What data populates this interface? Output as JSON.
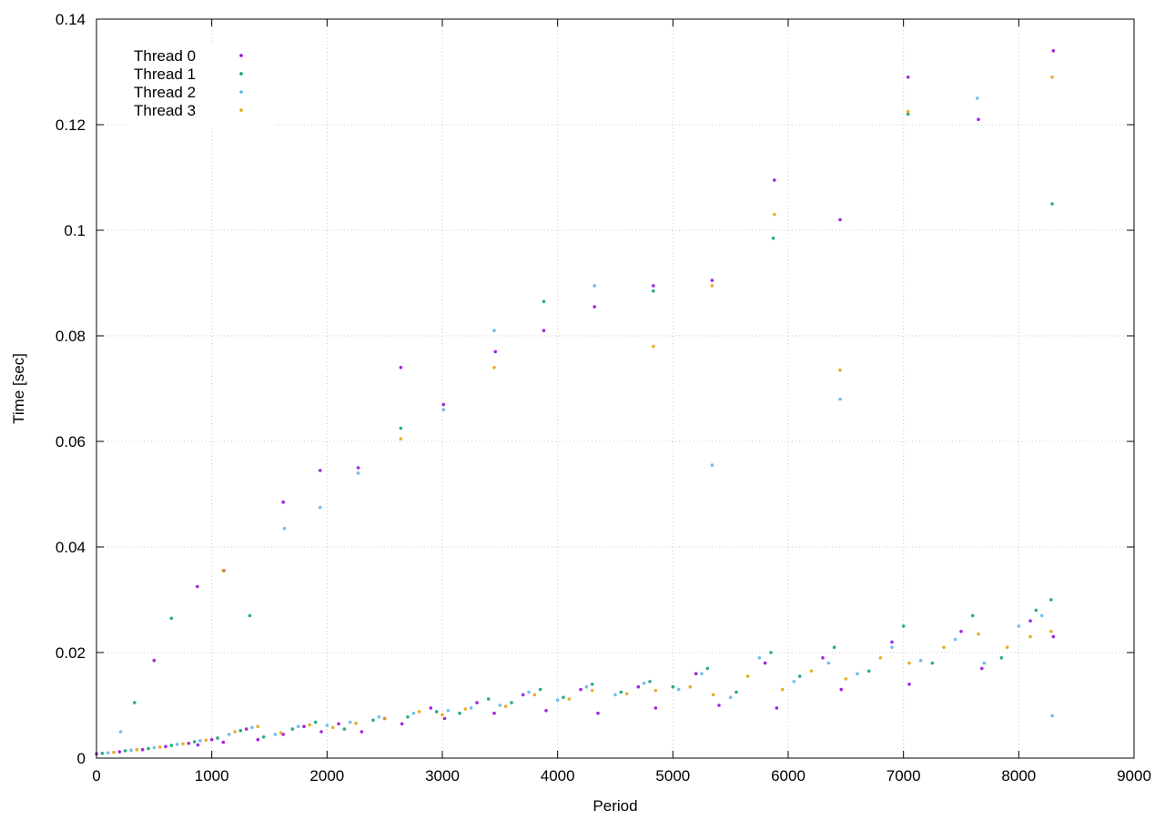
{
  "chart_data": {
    "type": "scatter",
    "title": "",
    "xlabel": "Period",
    "ylabel": "Time [sec]",
    "xlim": [
      0,
      9000
    ],
    "ylim": [
      0,
      0.14
    ],
    "xticks": [
      "0",
      "1000",
      "2000",
      "3000",
      "4000",
      "5000",
      "6000",
      "7000",
      "8000",
      "9000"
    ],
    "yticks": [
      "0",
      "0.02",
      "0.04",
      "0.06",
      "0.08",
      "0.1",
      "0.12",
      "0.14"
    ],
    "grid": true,
    "legend_position": "top-left",
    "series": [
      {
        "name": "Thread 0",
        "color": "#9400d3",
        "marker": "dot",
        "values": [
          [
            0,
            0.0008
          ],
          [
            200,
            0.0012
          ],
          [
            400,
            0.0016
          ],
          [
            600,
            0.0022
          ],
          [
            800,
            0.0028
          ],
          [
            880,
            0.0025
          ],
          [
            1000,
            0.0035
          ],
          [
            1100,
            0.003
          ],
          [
            1300,
            0.0055
          ],
          [
            1400,
            0.0035
          ],
          [
            1620,
            0.0045
          ],
          [
            1800,
            0.006
          ],
          [
            1950,
            0.005
          ],
          [
            2100,
            0.0065
          ],
          [
            2300,
            0.005
          ],
          [
            2500,
            0.0075
          ],
          [
            2650,
            0.0065
          ],
          [
            2900,
            0.0095
          ],
          [
            3020,
            0.0075
          ],
          [
            3300,
            0.0105
          ],
          [
            3450,
            0.0085
          ],
          [
            3700,
            0.012
          ],
          [
            3900,
            0.009
          ],
          [
            4200,
            0.013
          ],
          [
            4350,
            0.0085
          ],
          [
            4700,
            0.0135
          ],
          [
            4850,
            0.0095
          ],
          [
            5200,
            0.016
          ],
          [
            5400,
            0.01
          ],
          [
            5800,
            0.018
          ],
          [
            5900,
            0.0095
          ],
          [
            6300,
            0.019
          ],
          [
            6460,
            0.013
          ],
          [
            6900,
            0.022
          ],
          [
            7050,
            0.014
          ],
          [
            7500,
            0.024
          ],
          [
            7680,
            0.017
          ],
          [
            8100,
            0.026
          ],
          [
            8300,
            0.023
          ],
          [
            500,
            0.0185
          ],
          [
            875,
            0.0325
          ],
          [
            1105,
            0.0355
          ],
          [
            1620,
            0.0485
          ],
          [
            1940,
            0.0545
          ],
          [
            2270,
            0.055
          ],
          [
            2640,
            0.074
          ],
          [
            3010,
            0.067
          ],
          [
            3460,
            0.077
          ],
          [
            3880,
            0.081
          ],
          [
            4320,
            0.0855
          ],
          [
            4830,
            0.0895
          ],
          [
            5340,
            0.0905
          ],
          [
            5880,
            0.1095
          ],
          [
            6450,
            0.102
          ],
          [
            7040,
            0.129
          ],
          [
            7650,
            0.121
          ],
          [
            8300,
            0.134
          ]
        ]
      },
      {
        "name": "Thread 1",
        "color": "#009e73",
        "marker": "dot",
        "values": [
          [
            50,
            0.0009
          ],
          [
            250,
            0.0014
          ],
          [
            450,
            0.0018
          ],
          [
            650,
            0.0024
          ],
          [
            850,
            0.0031
          ],
          [
            1050,
            0.0038
          ],
          [
            1250,
            0.0052
          ],
          [
            1450,
            0.004
          ],
          [
            1700,
            0.0055
          ],
          [
            1900,
            0.0068
          ],
          [
            2150,
            0.0055
          ],
          [
            2400,
            0.0072
          ],
          [
            2700,
            0.0078
          ],
          [
            2950,
            0.0088
          ],
          [
            3150,
            0.0085
          ],
          [
            3400,
            0.0112
          ],
          [
            3600,
            0.0105
          ],
          [
            3850,
            0.013
          ],
          [
            4050,
            0.0115
          ],
          [
            4300,
            0.014
          ],
          [
            4550,
            0.0125
          ],
          [
            4800,
            0.0145
          ],
          [
            5000,
            0.0135
          ],
          [
            5300,
            0.017
          ],
          [
            5550,
            0.0125
          ],
          [
            5850,
            0.02
          ],
          [
            6100,
            0.0155
          ],
          [
            6400,
            0.021
          ],
          [
            6700,
            0.0165
          ],
          [
            7000,
            0.025
          ],
          [
            7250,
            0.018
          ],
          [
            7600,
            0.027
          ],
          [
            7850,
            0.019
          ],
          [
            8150,
            0.028
          ],
          [
            8280,
            0.03
          ],
          [
            330,
            0.0105
          ],
          [
            650,
            0.0265
          ],
          [
            1330,
            0.027
          ],
          [
            2640,
            0.0625
          ],
          [
            3880,
            0.0865
          ],
          [
            4830,
            0.0885
          ],
          [
            5870,
            0.0985
          ],
          [
            7040,
            0.122
          ],
          [
            8290,
            0.105
          ]
        ]
      },
      {
        "name": "Thread 2",
        "color": "#56b4e9",
        "marker": "dot",
        "values": [
          [
            100,
            0.001
          ],
          [
            300,
            0.0015
          ],
          [
            500,
            0.002
          ],
          [
            700,
            0.0026
          ],
          [
            900,
            0.0033
          ],
          [
            1150,
            0.0045
          ],
          [
            1350,
            0.0058
          ],
          [
            1550,
            0.0045
          ],
          [
            1750,
            0.006
          ],
          [
            2000,
            0.0062
          ],
          [
            2200,
            0.0068
          ],
          [
            2450,
            0.0078
          ],
          [
            2750,
            0.0085
          ],
          [
            3050,
            0.009
          ],
          [
            3250,
            0.0095
          ],
          [
            3500,
            0.01
          ],
          [
            3750,
            0.0125
          ],
          [
            4000,
            0.011
          ],
          [
            4250,
            0.0135
          ],
          [
            4500,
            0.012
          ],
          [
            4750,
            0.0142
          ],
          [
            5050,
            0.013
          ],
          [
            5250,
            0.016
          ],
          [
            5500,
            0.0115
          ],
          [
            5750,
            0.019
          ],
          [
            6050,
            0.0145
          ],
          [
            6350,
            0.018
          ],
          [
            6600,
            0.016
          ],
          [
            6900,
            0.021
          ],
          [
            7150,
            0.0185
          ],
          [
            7450,
            0.0225
          ],
          [
            7700,
            0.018
          ],
          [
            8000,
            0.025
          ],
          [
            8200,
            0.027
          ],
          [
            8290,
            0.008
          ],
          [
            210,
            0.005
          ],
          [
            1630,
            0.0435
          ],
          [
            1940,
            0.0475
          ],
          [
            2270,
            0.054
          ],
          [
            3010,
            0.066
          ],
          [
            3450,
            0.081
          ],
          [
            4320,
            0.0895
          ],
          [
            5340,
            0.0555
          ],
          [
            6450,
            0.068
          ],
          [
            7640,
            0.125
          ]
        ]
      },
      {
        "name": "Thread 3",
        "color": "#e69f00",
        "marker": "dot",
        "values": [
          [
            150,
            0.0011
          ],
          [
            350,
            0.0016
          ],
          [
            550,
            0.0021
          ],
          [
            750,
            0.0027
          ],
          [
            950,
            0.0034
          ],
          [
            1200,
            0.005
          ],
          [
            1400,
            0.006
          ],
          [
            1600,
            0.0048
          ],
          [
            1850,
            0.0063
          ],
          [
            2050,
            0.0058
          ],
          [
            2250,
            0.0066
          ],
          [
            2500,
            0.0075
          ],
          [
            2800,
            0.0088
          ],
          [
            3000,
            0.0082
          ],
          [
            3200,
            0.0093
          ],
          [
            3550,
            0.0098
          ],
          [
            3800,
            0.012
          ],
          [
            4100,
            0.0112
          ],
          [
            4300,
            0.0128
          ],
          [
            4600,
            0.0122
          ],
          [
            4850,
            0.0128
          ],
          [
            5150,
            0.0135
          ],
          [
            5350,
            0.012
          ],
          [
            5650,
            0.0155
          ],
          [
            5950,
            0.013
          ],
          [
            6200,
            0.0165
          ],
          [
            6500,
            0.015
          ],
          [
            6800,
            0.019
          ],
          [
            7050,
            0.018
          ],
          [
            7350,
            0.021
          ],
          [
            7650,
            0.0235
          ],
          [
            7900,
            0.021
          ],
          [
            8100,
            0.023
          ],
          [
            8280,
            0.024
          ],
          [
            1100,
            0.0355
          ],
          [
            2640,
            0.0605
          ],
          [
            3450,
            0.074
          ],
          [
            4830,
            0.078
          ],
          [
            5340,
            0.0895
          ],
          [
            5880,
            0.103
          ],
          [
            6450,
            0.0735
          ],
          [
            7040,
            0.1225
          ],
          [
            8290,
            0.129
          ]
        ]
      }
    ]
  }
}
